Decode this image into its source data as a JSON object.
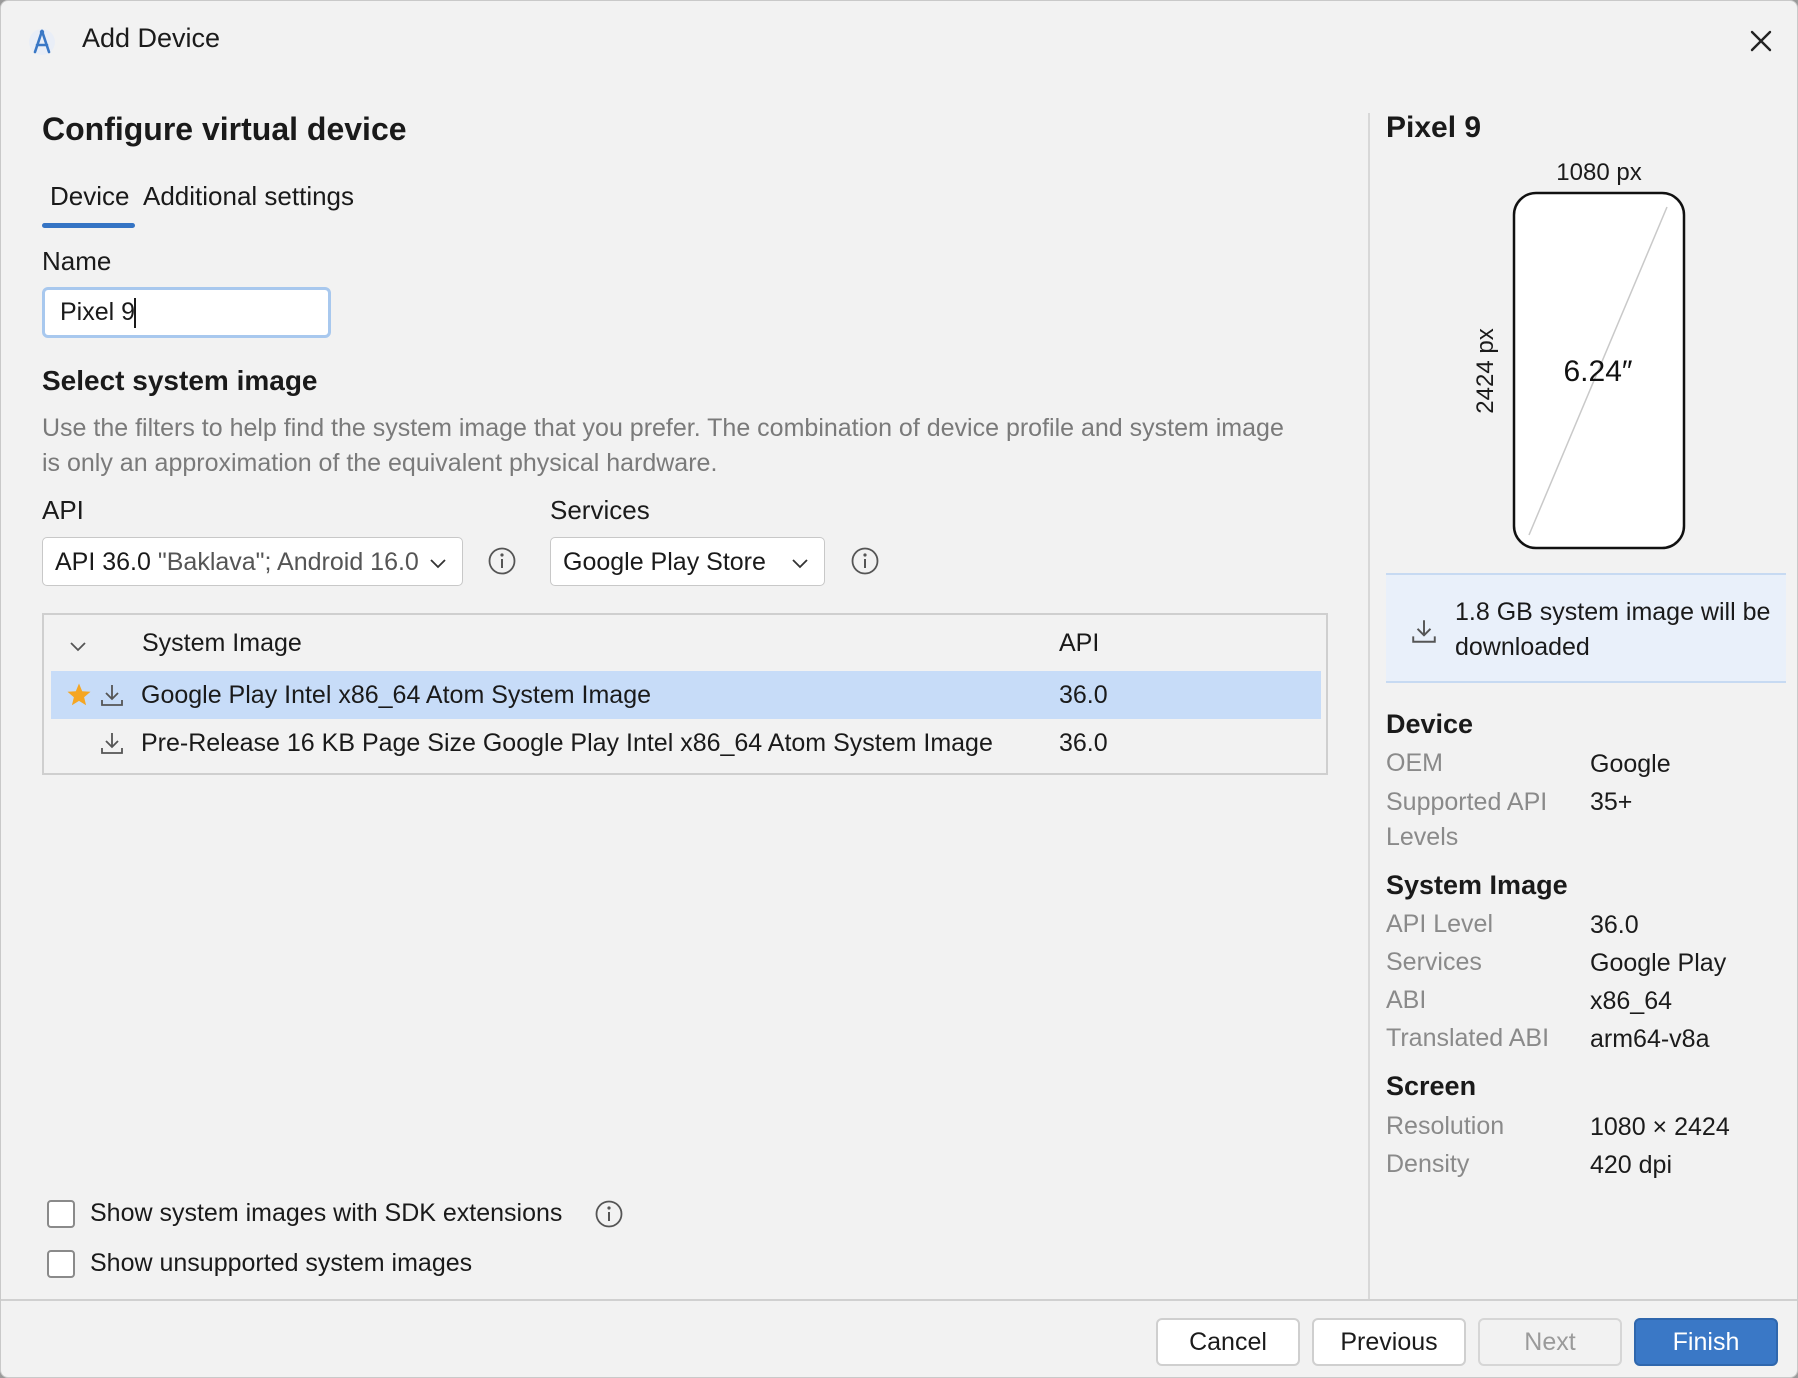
{
  "window": {
    "title": "Add Device",
    "close_icon": "close-icon",
    "app_icon": "android-studio-icon"
  },
  "main": {
    "heading": "Configure virtual device",
    "tabs": [
      {
        "label": "Device",
        "selected": true
      },
      {
        "label": "Additional settings",
        "selected": false
      }
    ],
    "name_label": "Name",
    "name_value": "Pixel 9",
    "system_image_heading": "Select system image",
    "description": "Use the filters to help find the system image that you prefer. The combination of device profile and system image is only an approximation of the equivalent physical hardware.",
    "api_label": "API",
    "api_value_main": "API 36.0",
    "api_value_detail": "\"Baklava\"; Android 16.0",
    "services_label": "Services",
    "services_value": "Google Play Store",
    "table": {
      "columns": [
        "System Image",
        "API"
      ],
      "rows": [
        {
          "name": "Google Play Intel x86_64 Atom System Image",
          "api": "36.0",
          "selected": true,
          "recommended": true
        },
        {
          "name": "Pre-Release 16 KB Page Size Google Play Intel x86_64 Atom System Image",
          "api": "36.0",
          "selected": false,
          "recommended": false
        }
      ]
    },
    "checkboxes": [
      {
        "label": "Show system images with SDK extensions",
        "checked": false
      },
      {
        "label": "Show unsupported system images",
        "checked": false
      }
    ]
  },
  "preview": {
    "device_name": "Pixel 9",
    "width_label": "1080 px",
    "height_label": "2424 px",
    "diagonal_label": "6.24″",
    "download_notice": "1.8 GB system image will be downloaded",
    "device_section": "Device",
    "oem_key": "OEM",
    "oem_value": "Google",
    "api_levels_key": "Supported API Levels",
    "api_levels_value": "35+",
    "system_image_section": "System Image",
    "api_level_key": "API Level",
    "api_level_value": "36.0",
    "services_key": "Services",
    "services_value": "Google Play",
    "abi_key": "ABI",
    "abi_value": "x86_64",
    "translated_abi_key": "Translated ABI",
    "translated_abi_value": "arm64-v8a",
    "screen_section": "Screen",
    "resolution_key": "Resolution",
    "resolution_value": "1080 × 2424",
    "density_key": "Density",
    "density_value": "420 dpi"
  },
  "footer": {
    "cancel": "Cancel",
    "previous": "Previous",
    "next": "Next",
    "finish": "Finish"
  },
  "colors": {
    "accent": "#3574c4",
    "selected_row": "#c7dcf8",
    "star": "#f5a623",
    "finish": "#3a78c6"
  }
}
